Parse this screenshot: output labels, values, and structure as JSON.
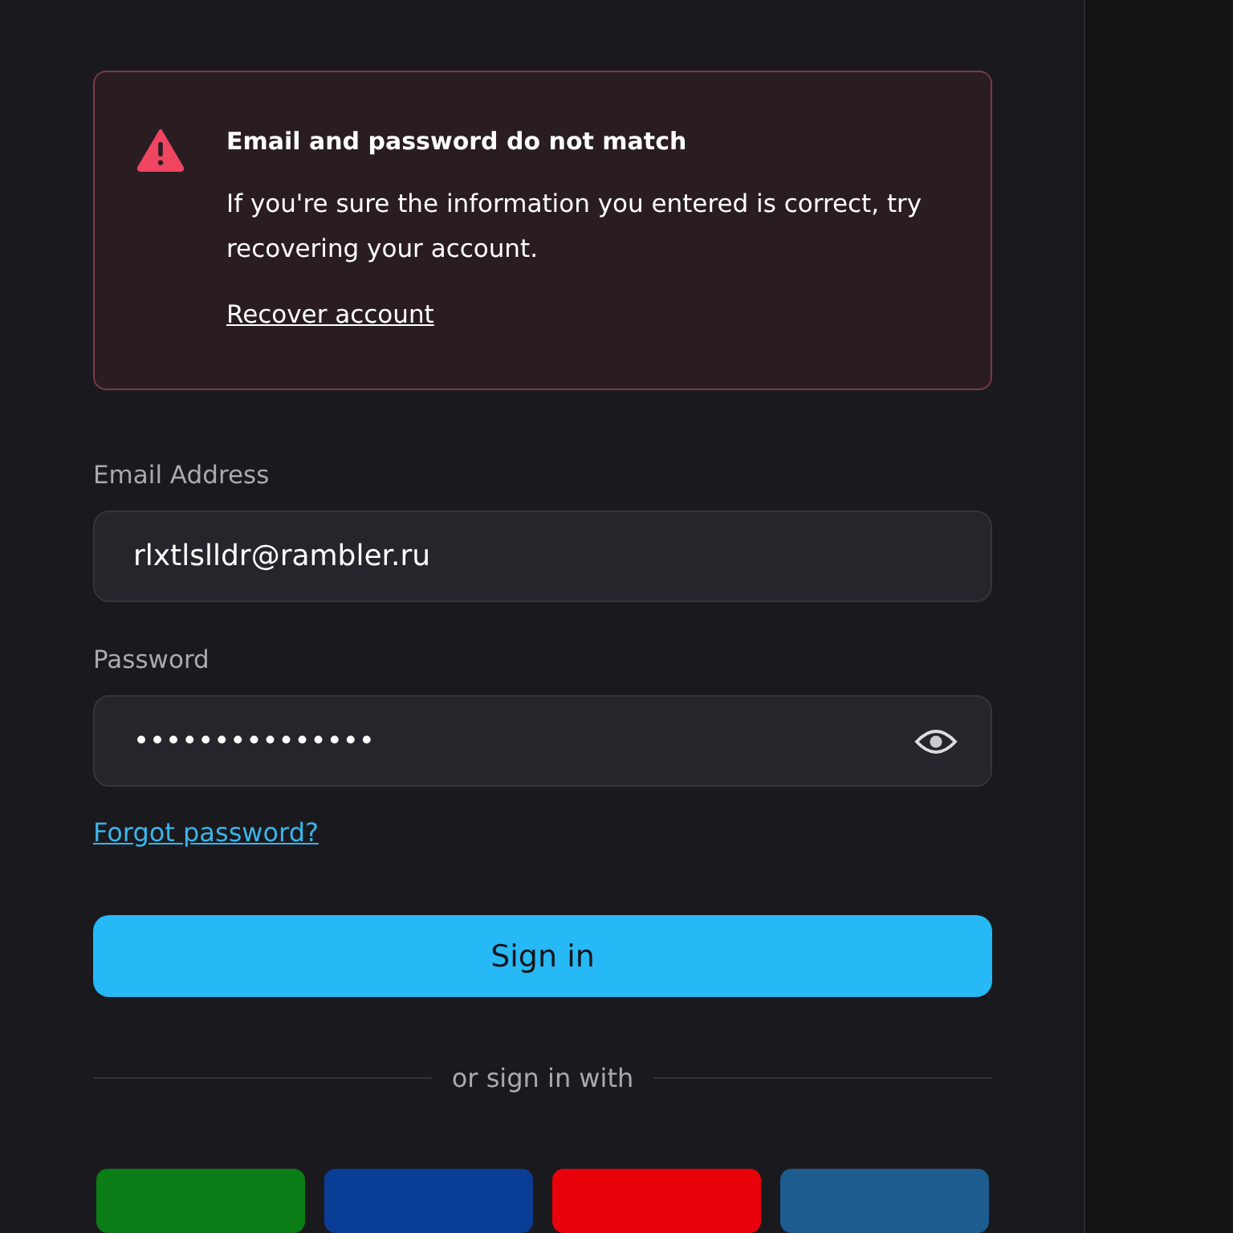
{
  "alert": {
    "title": "Email and password do not match",
    "message": "If you're sure the information you entered is correct, try recovering your account.",
    "link": "Recover account"
  },
  "fields": [
    {
      "label": "Email Address",
      "value": "rlxtlslldr@rambler.ru",
      "kind": "text"
    },
    {
      "label": "Password",
      "value": "•••••••••••••••",
      "kind": "password"
    }
  ],
  "forgot_link": "Forgot password?",
  "submit": "Sign in",
  "divider_text": "or sign in with",
  "social_buttons": [
    {
      "color": "#0a7d16"
    },
    {
      "color": "#0a3d96"
    },
    {
      "color": "#e8000b"
    },
    {
      "color": "#1d5c8f"
    }
  ]
}
